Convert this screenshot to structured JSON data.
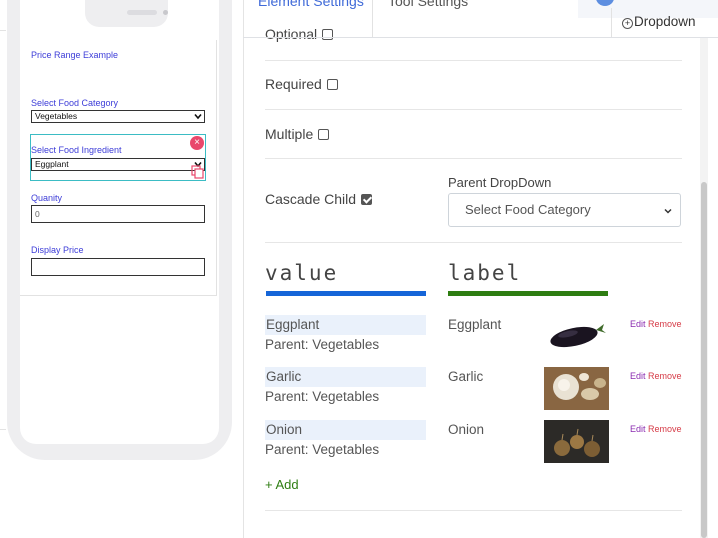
{
  "phone_preview": {
    "form_title": "Price Range Example",
    "fields": {
      "category": {
        "label": "Select Food Category",
        "value": "Vegetables"
      },
      "ingredient": {
        "label": "Select Food Ingredient",
        "value": "Eggplant"
      },
      "quantity": {
        "label": "Quanity",
        "value": "0"
      },
      "display_price": {
        "label": "Display Price",
        "value": ""
      }
    },
    "remove_badge": "×"
  },
  "tabs": {
    "element_settings": "Element Settings",
    "tool_settings": "Tool Settings",
    "dropdown": "Dropdown"
  },
  "settings": {
    "optional_label": "Optional",
    "required_label": "Required",
    "multiple_label": "Multiple",
    "cascade_child_label": "Cascade Child",
    "cascade_child_checked": true,
    "parent_dropdown_label": "Parent DropDown",
    "parent_dropdown_value": "Select Food Category"
  },
  "options_table": {
    "value_header": "value",
    "label_header": "label",
    "value_bar_color": "#1565d8",
    "label_bar_color": "#2e7d12",
    "rows": [
      {
        "value": "Eggplant",
        "parent": "Parent: Vegetables",
        "label": "Eggplant",
        "image": "eggplant-photo",
        "edit": "Edit",
        "remove": "Remove"
      },
      {
        "value": "Garlic",
        "parent": "Parent: Vegetables",
        "label": "Garlic",
        "image": "garlic-photo",
        "edit": "Edit",
        "remove": "Remove"
      },
      {
        "value": "Onion",
        "parent": "Parent: Vegetables",
        "label": "Onion",
        "image": "onion-photo",
        "edit": "Edit",
        "remove": "Remove"
      }
    ],
    "add_label": "+ Add"
  },
  "colors": {
    "accent_blue": "#3f6ad8",
    "field_label": "#3d3dd8",
    "selected_outline": "#3bbcc4",
    "remove_badge": "#e9486c"
  }
}
